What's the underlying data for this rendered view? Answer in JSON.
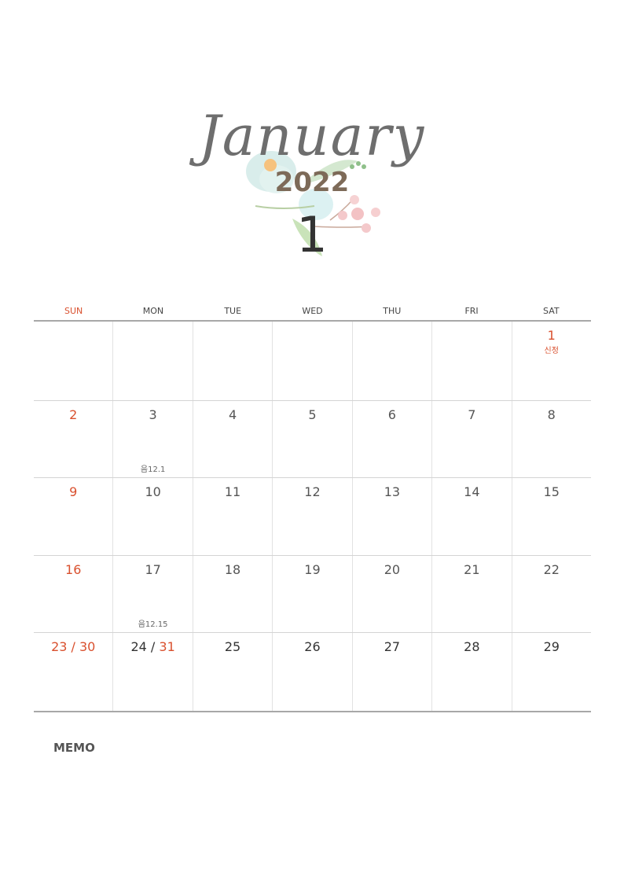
{
  "header": {
    "month_name": "January",
    "year": "2022",
    "month_number": "1"
  },
  "weekdays": [
    "SUN",
    "MON",
    "TUE",
    "WED",
    "THU",
    "FRI",
    "SAT"
  ],
  "weeks": [
    {
      "days": [
        {
          "d": ""
        },
        {
          "d": ""
        },
        {
          "d": ""
        },
        {
          "d": ""
        },
        {
          "d": ""
        },
        {
          "d": ""
        },
        {
          "d": "1",
          "note": "신정"
        }
      ]
    },
    {
      "days": [
        {
          "d": "2"
        },
        {
          "d": "3",
          "lunar": "음12.1"
        },
        {
          "d": "4"
        },
        {
          "d": "5"
        },
        {
          "d": "6"
        },
        {
          "d": "7"
        },
        {
          "d": "8"
        }
      ]
    },
    {
      "days": [
        {
          "d": "9"
        },
        {
          "d": "10"
        },
        {
          "d": "11"
        },
        {
          "d": "12"
        },
        {
          "d": "13"
        },
        {
          "d": "14"
        },
        {
          "d": "15"
        }
      ]
    },
    {
      "days": [
        {
          "d": "16"
        },
        {
          "d": "17",
          "lunar": "음12.15"
        },
        {
          "d": "18"
        },
        {
          "d": "19"
        },
        {
          "d": "20"
        },
        {
          "d": "21"
        },
        {
          "d": "22"
        }
      ]
    },
    {
      "days": [
        {
          "d": "23 / 30"
        },
        {
          "d1": "24 / ",
          "d2": "31"
        },
        {
          "d": "25"
        },
        {
          "d": "26"
        },
        {
          "d": "27"
        },
        {
          "d": "28"
        },
        {
          "d": "29"
        }
      ]
    }
  ],
  "memo_label": "MEMO",
  "colors": {
    "sunday": "#d9502e",
    "text": "#555555",
    "year": "#7d6a58"
  }
}
